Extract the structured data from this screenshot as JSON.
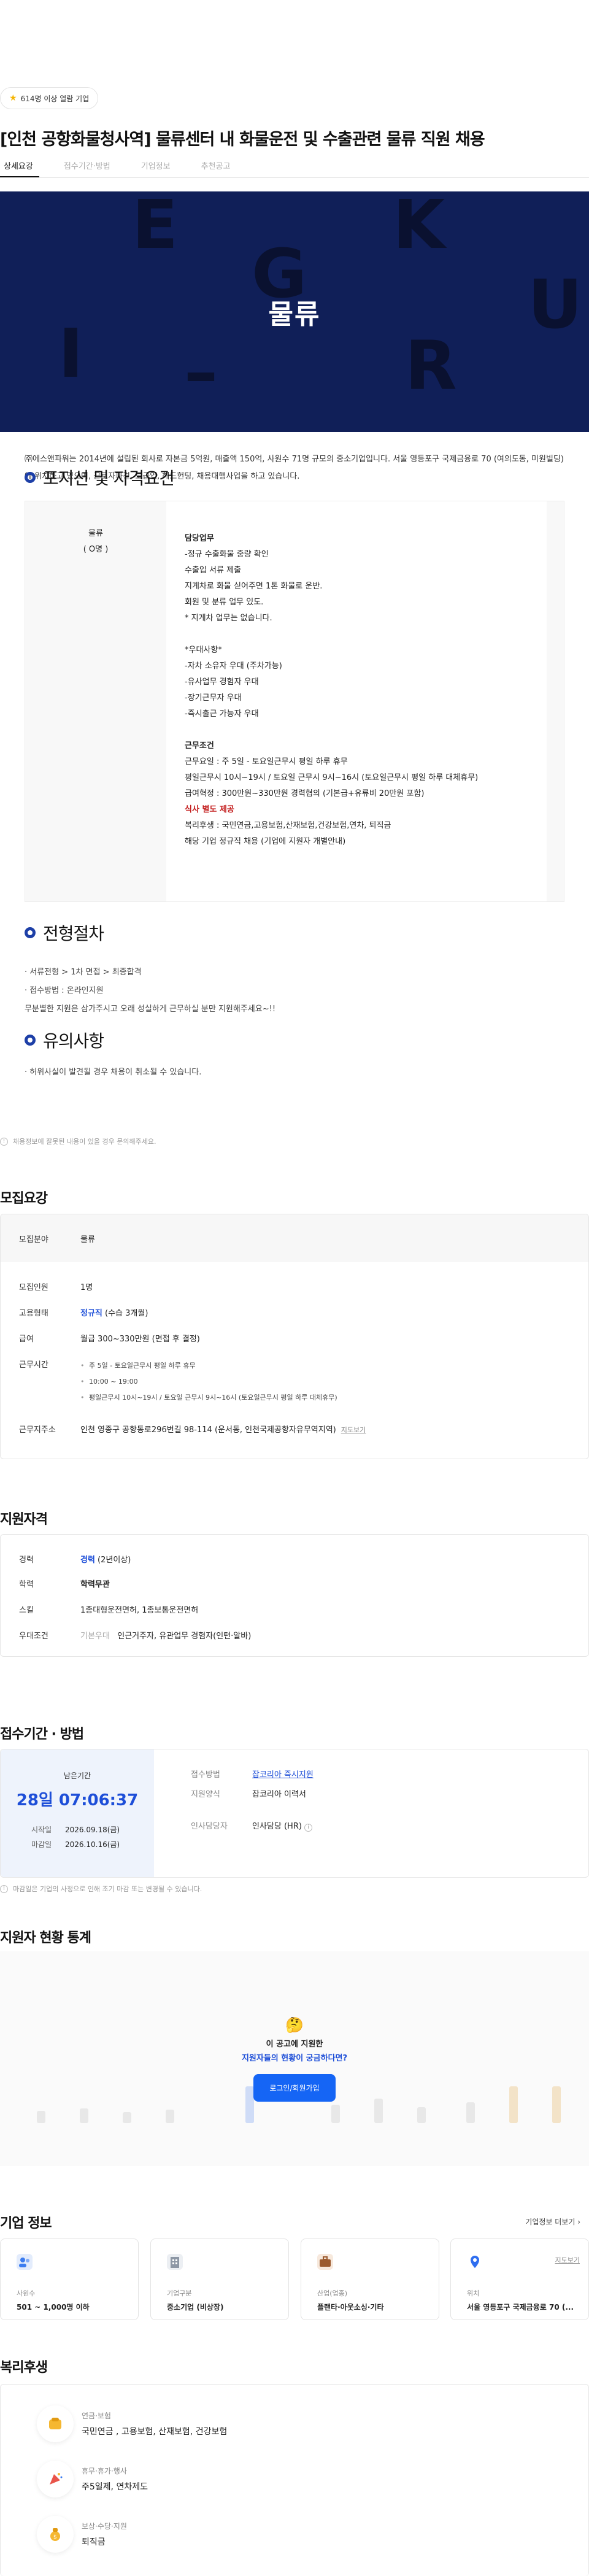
{
  "badge": {
    "icon": "star-icon",
    "text": "614명 이상 열람 기업"
  },
  "job_title": "[인천 공항화물청사역] 물류센터 내 화물운전 및 수출관련 물류 직원 채용",
  "tabs": [
    {
      "label": "상세요강"
    },
    {
      "label": "접수기간·방법"
    },
    {
      "label": "기업정보"
    },
    {
      "label": "추천공고"
    }
  ],
  "hero": {
    "title": "물류"
  },
  "intro": "㈜에스앤파워는 2014년에 설립된 회사로 자본금 5억원, 매출액 150억, 사원수 71명 규모의 중소기업입니다. 서울 영등포구 국제금융로 70 (여의도동, 미원빌딩)에 위치하고 있으며, 근로자파견, 도급업, 헤드헌팅, 채용대행사업을 하고 있습니다.",
  "sections": {
    "qual": "포지션 및 자격요건",
    "process": "전형절차",
    "caution": "유의사항"
  },
  "position": {
    "name": "물류",
    "count": "( O명 )"
  },
  "duties_title": "담당업무",
  "duties": [
    "-정규 수출화물 중량 확인",
    "수출입 서류 제출",
    "지게차로 화물 싣어주면 1톤 화물로 운반.",
    "회원 및 분류 업무 있도.",
    "* 지게차 업무는 없습니다."
  ],
  "pref_title": "*우대사항*",
  "prefs": [
    "-자차 소유자 우대 (주차가능)",
    "-유사업무 경험자 우대",
    "-장기근무자 우대",
    "-즉시출근 가능자 우대"
  ],
  "cond_title": "근무조건",
  "conds": [
    "근무요일 : 주 5일 - 토요일근무시 평일 하루 휴무",
    "평일근무시 10시~19시 / 토요일 근무시 9시~16시 (토요일근무시 평일 하루 대체휴무)",
    "급여혁정 : 300만원~330만원 경력협의 (기본급+유류비 20만원 포함)"
  ],
  "meal": "식사 별도 제공",
  "welfare": [
    "복리후생 : 국민연금,고용보험,산재보험,건강보험,연차, 퇴직금",
    "해당 기업 정규직 채용 (기업에 지원자 개별안내)"
  ],
  "process": [
    "· 서류전형 > 1차 면접 > 최종합격",
    "· 접수방법 : 온라인지원",
    "무분별한 지원은 삼가주시고 오래 성실하게 근무하실 분만 지원해주세요~!!"
  ],
  "caution": "· 허위사실이 발견될 경우 채용이 취소될 수 있습니다.",
  "footnote": "채용정보에 잘못된 내용이 있을 경우 문의해주세요.",
  "summary": {
    "title": "모집요강",
    "field_k": "모집분야",
    "field_v": "물류",
    "count_k": "모집인원",
    "count_v": "1명",
    "type_k": "고용형태",
    "type_v": "정규직",
    "type_sub": " (수습 3개월)",
    "pay_k": "급여",
    "pay_v": "월급 300~330만원 (면접 후 결정)",
    "time_k": "근무시간",
    "times": [
      "주 5일 - 토요일근무시 평일 하루 휴무",
      "10:00 ~ 19:00",
      "평일근무시 10시~19시 / 토요일 근무시 9시~16시 (토요일근무시 평일 하루 대체휴무)"
    ],
    "addr_k": "근무지주소",
    "addr_v": "인천 영종구 공항동로296번길 98-114 (운서동, 인천국제공항자유무역지역)",
    "map": "지도보기"
  },
  "qualification": {
    "title": "지원자격",
    "career_k": "경력",
    "career_v": "경력",
    "career_sub": " (2년이상)",
    "edu_k": "학력",
    "edu_v": "학력무관",
    "skill_k": "스킬",
    "skill_v": "1종대형운전면허, 1종보통운전면허",
    "pref_k": "우대조건",
    "pref_tag": "기본우대",
    "pref_v": "인근거주자, 유관업무 경험자(인턴·알바)"
  },
  "apply": {
    "title": "접수기간 · 방법",
    "remain_label": "남은기간",
    "remain": "28일 07:06:37",
    "start_k": "시작일",
    "start_v": "2026.09.18(금)",
    "end_k": "마감일",
    "end_v": "2026.10.16(금)",
    "method_k": "접수방법",
    "method_v": "잡코리아 즉시지원",
    "form_k": "지원양식",
    "form_v": "잡코리아 이력서",
    "hr_k": "인사담당자",
    "hr_v": "인사담당 (HR)",
    "note": "마감일은 기업의 사정으로 인해 조기 마감 또는 변경될 수 있습니다."
  },
  "stats": {
    "title": "지원자 현황 통계",
    "q1": "이 공고에 지원한",
    "q2": "지원자들의 현황이 궁금하다면?",
    "btn": "로그인/회원가입"
  },
  "company": {
    "title": "기업 정보",
    "more": "기업정보 더보기 ›",
    "cards": [
      {
        "icon": "people-icon",
        "label": "사원수",
        "value": "501 ~ 1,000명 이하"
      },
      {
        "icon": "building-icon",
        "label": "기업구분",
        "value": "중소기업 (비상장)"
      },
      {
        "icon": "briefcase-icon",
        "label": "산업(업종)",
        "value": "플랜타·아웃소싱·기타"
      },
      {
        "icon": "location-icon",
        "label": "위치",
        "value": "서울 영등포구 국제금융로 70 (...",
        "map": "지도보기"
      }
    ]
  },
  "benefits": {
    "title": "복리후생",
    "items": [
      {
        "icon": "shield-icon",
        "title": "연금·보험",
        "desc": "국민연금 , 고용보험, 산재보험, 건강보험"
      },
      {
        "icon": "party-icon",
        "title": "휴무·휴가·행사",
        "desc": "주5일제, 연차제도"
      },
      {
        "icon": "money-bag-icon",
        "title": "보상·수당·지원",
        "desc": "퇴직금"
      }
    ]
  },
  "colors": {
    "accent": "#1d4ed8",
    "hero_bg": "#101f58",
    "button": "#1565f5"
  }
}
